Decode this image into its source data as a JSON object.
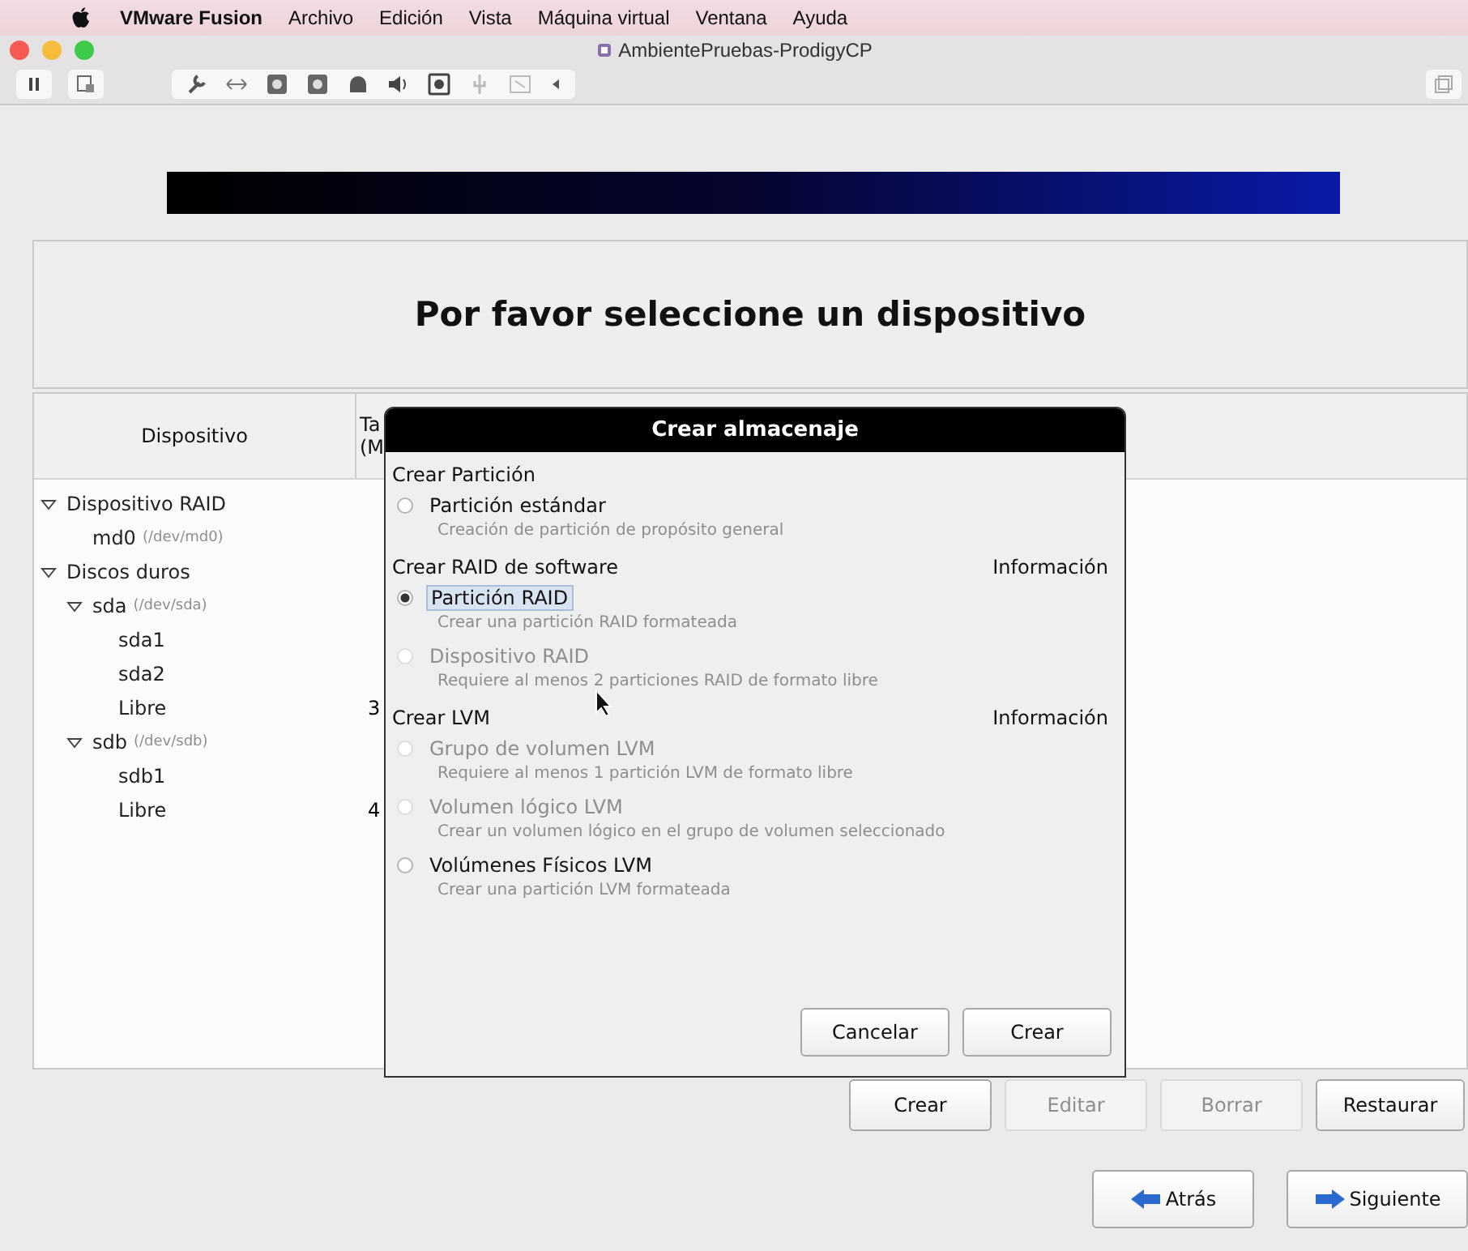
{
  "menu_bar": {
    "app": "VMware Fusion",
    "items": [
      "Archivo",
      "Edición",
      "Vista",
      "Máquina virtual",
      "Ventana",
      "Ayuda"
    ]
  },
  "window": {
    "title": "AmbientePruebas-ProdigyCP"
  },
  "installer": {
    "heading": "Por favor seleccione un dispositivo",
    "table": {
      "columns": [
        "Dispositivo",
        "Ta\n(M"
      ],
      "rows": [
        {
          "label": "Dispositivo RAID",
          "expanded": true,
          "children": [
            {
              "label": "md0",
              "note": "(/dev/md0)"
            }
          ]
        },
        {
          "label": "Discos duros",
          "expanded": true,
          "children": [
            {
              "label": "sda",
              "note": "(/dev/sda)",
              "expanded": true,
              "children": [
                {
                  "label": "sda1"
                },
                {
                  "label": "sda2"
                },
                {
                  "label": "Libre",
                  "size": "3"
                }
              ]
            },
            {
              "label": "sdb",
              "note": "(/dev/sdb)",
              "expanded": true,
              "children": [
                {
                  "label": "sdb1"
                },
                {
                  "label": "Libre",
                  "size": "4"
                }
              ]
            }
          ]
        }
      ]
    },
    "table_buttons": [
      {
        "label": "Crear",
        "disabled": false
      },
      {
        "label": "Editar",
        "disabled": true
      },
      {
        "label": "Borrar",
        "disabled": true
      },
      {
        "label": "Restaurar",
        "disabled": false
      }
    ],
    "nav_buttons": [
      {
        "label": "Atrás",
        "kind": "back"
      },
      {
        "label": "Siguiente",
        "kind": "next"
      }
    ]
  },
  "dialog": {
    "title": "Crear almacenaje",
    "items": [
      {
        "kind": "section",
        "label": "Crear Partición"
      },
      {
        "kind": "option",
        "label": "Partición estándar",
        "description": "Creación de partición de propósito general",
        "selected": false,
        "disabled": false,
        "focused": false
      },
      {
        "kind": "section",
        "label": "Crear RAID de software",
        "info": "Información"
      },
      {
        "kind": "option",
        "label": "Partición RAID",
        "description": "Crear una partición RAID formateada",
        "selected": true,
        "disabled": false,
        "focused": true
      },
      {
        "kind": "option",
        "label": "Dispositivo RAID",
        "description": "Requiere al menos 2 particiones RAID de formato libre",
        "selected": false,
        "disabled": true,
        "focused": false
      },
      {
        "kind": "section",
        "label": "Crear LVM",
        "info": "Información"
      },
      {
        "kind": "option",
        "label": "Grupo de volumen LVM",
        "description": "Requiere al menos 1 partición LVM de formato libre",
        "selected": false,
        "disabled": true,
        "focused": false
      },
      {
        "kind": "option",
        "label": "Volumen lógico LVM",
        "description": "Crear un volumen lógico en el grupo de volumen seleccionado",
        "selected": false,
        "disabled": true,
        "focused": false
      },
      {
        "kind": "option",
        "label": "Volúmenes Físicos LVM",
        "description": "Crear una partición LVM formateada",
        "selected": false,
        "disabled": false,
        "focused": false
      }
    ],
    "buttons": [
      "Cancelar",
      "Crear"
    ]
  }
}
